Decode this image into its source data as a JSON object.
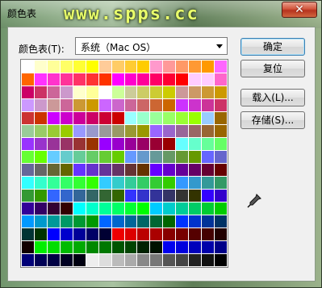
{
  "window": {
    "title": "颜色表",
    "watermark": "www.spps.cc",
    "close_label": "✕"
  },
  "swatches": {
    "label": "颜色表(T):",
    "selected": "系统（Mac OS）"
  },
  "buttons": {
    "ok": "确定",
    "reset": "复位",
    "load": "载入(L)...",
    "save": "存储(S)..."
  },
  "icons": {
    "eyedropper": "eyedropper-icon"
  },
  "palette": {
    "rows": 16,
    "cols": 16,
    "colors": [
      [
        "#ffffff",
        "#ffffcc",
        "#ffff99",
        "#ffff66",
        "#ffff33",
        "#ffff00",
        "#ffcc99",
        "#ffcc66",
        "#ffcc33",
        "#ffcc00",
        "#ff99cc",
        "#ff9999",
        "#ff9966",
        "#ff9933",
        "#ff9900",
        "#ff66ff"
      ],
      [
        "#ff6600",
        "#ff33ff",
        "#ff33cc",
        "#ff3399",
        "#ff3366",
        "#ff3333",
        "#ff3300",
        "#ff00ff",
        "#ff00cc",
        "#ff0099",
        "#ff0066",
        "#ff0033",
        "#ff0000",
        "#ffccff",
        "#ffccff",
        "#ff66cc"
      ],
      [
        "#cc0066",
        "#cc3366",
        "#cc6699",
        "#cc99cc",
        "#ffffcc",
        "#ffff99",
        "#ffffff",
        "#ccff99",
        "#cccc99",
        "#cccc66",
        "#cccc33",
        "#cccc00",
        "#cc9999",
        "#cc9966",
        "#cc9933",
        "#cc9900"
      ],
      [
        "#cc99ff",
        "#cc99cc",
        "#cc9999",
        "#cc6699",
        "#cc9933",
        "#cc9900",
        "#cc66ff",
        "#cc66cc",
        "#cc6699",
        "#cc6666",
        "#cc6633",
        "#cc6600",
        "#cc33ff",
        "#cc33cc",
        "#cc3399",
        "#cc3366"
      ],
      [
        "#cc3333",
        "#cc3300",
        "#cc00ff",
        "#cc00cc",
        "#cc0099",
        "#cc0066",
        "#cc0033",
        "#cc0000",
        "#99ffff",
        "#99ffcc",
        "#99ff99",
        "#99ff66",
        "#99ff33",
        "#99ff00",
        "#99ccff",
        "#996600"
      ],
      [
        "#99cc99",
        "#99cc66",
        "#99cc33",
        "#99cc00",
        "#9999ff",
        "#9999cc",
        "#999999",
        "#999966",
        "#999933",
        "#999900",
        "#9966ff",
        "#9966cc",
        "#996699",
        "#996666",
        "#996633",
        "#996600"
      ],
      [
        "#9933ff",
        "#9933cc",
        "#993399",
        "#993366",
        "#993333",
        "#993300",
        "#9900ff",
        "#9900cc",
        "#990099",
        "#990066",
        "#990033",
        "#990000",
        "#66ffff",
        "#66ffcc",
        "#66ff99",
        "#66ff66"
      ],
      [
        "#66ff33",
        "#66ff00",
        "#66ccff",
        "#66cccc",
        "#66cc99",
        "#66cc66",
        "#66cc33",
        "#66cc00",
        "#6699ff",
        "#6699cc",
        "#669999",
        "#669966",
        "#669933",
        "#669900",
        "#6666ff",
        "#6666cc"
      ],
      [
        "#666699",
        "#666666",
        "#666633",
        "#666600",
        "#6633ff",
        "#6633cc",
        "#663399",
        "#663366",
        "#663333",
        "#663300",
        "#6600ff",
        "#6600cc",
        "#660099",
        "#660066",
        "#660033",
        "#660000"
      ],
      [
        "#33ffff",
        "#33ffcc",
        "#33ff99",
        "#33ff66",
        "#33ff33",
        "#33ff00",
        "#33ccff",
        "#33cccc",
        "#33cc99",
        "#33cc66",
        "#33cc33",
        "#33cc00",
        "#3399ff",
        "#3399cc",
        "#339999",
        "#339966"
      ],
      [
        "#339933",
        "#339900",
        "#3366ff",
        "#3366cc",
        "#336699",
        "#336666",
        "#336633",
        "#336600",
        "#3333ff",
        "#3333cc",
        "#333399",
        "#333366",
        "#333333",
        "#333300",
        "#3300ff",
        "#3300cc"
      ],
      [
        "#330099",
        "#330066",
        "#330033",
        "#330000",
        "#00ffff",
        "#00ffcc",
        "#00ff99",
        "#00ff66",
        "#00ff33",
        "#00ff00",
        "#00ccff",
        "#00cccc",
        "#00cc99",
        "#00cc66",
        "#00cc33",
        "#00cc00"
      ],
      [
        "#0099ff",
        "#0099cc",
        "#009999",
        "#009966",
        "#009933",
        "#009900",
        "#0066ff",
        "#0066cc",
        "#006699",
        "#006666",
        "#006633",
        "#006600",
        "#0033ff",
        "#0033cc",
        "#003399",
        "#003366"
      ],
      [
        "#003333",
        "#003300",
        "#0000ff",
        "#0000cc",
        "#000099",
        "#000066",
        "#000033",
        "#ee0000",
        "#dd0000",
        "#bb0000",
        "#aa0000",
        "#880000",
        "#770000",
        "#550000",
        "#440000",
        "#220000"
      ],
      [
        "#110000",
        "#00ee00",
        "#00dd00",
        "#00bb00",
        "#00aa00",
        "#008800",
        "#007700",
        "#005500",
        "#004400",
        "#002200",
        "#001100",
        "#0000ee",
        "#0000dd",
        "#0000bb",
        "#0000aa",
        "#000088"
      ],
      [
        "#000077",
        "#000055",
        "#000044",
        "#000022",
        "#000011",
        "#eeeeee",
        "#dddddd",
        "#bbbbbb",
        "#aaaaaa",
        "#888888",
        "#777777",
        "#555555",
        "#444444",
        "#222222",
        "#111111",
        "#000000"
      ]
    ]
  }
}
